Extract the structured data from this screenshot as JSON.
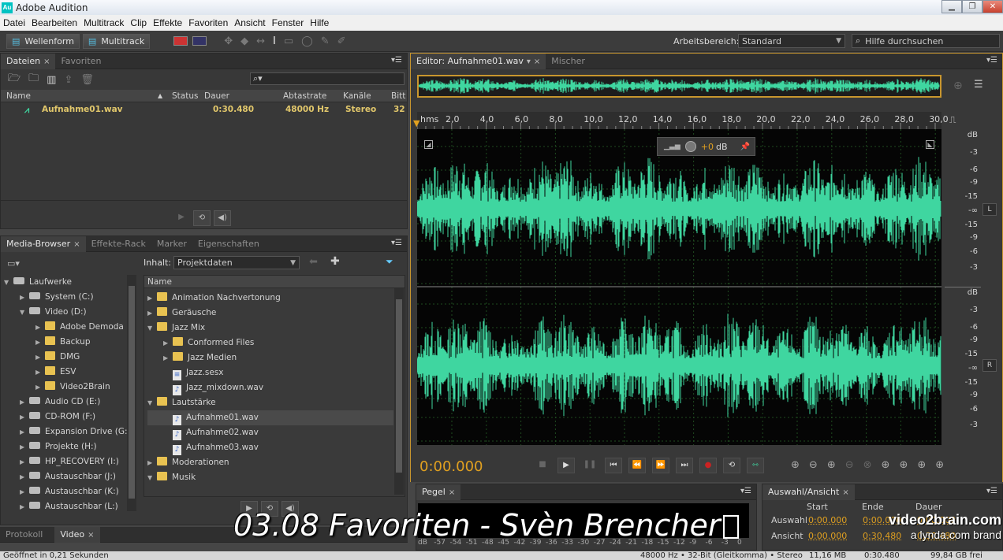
{
  "window": {
    "title": "Adobe Audition",
    "app_icon": "Au"
  },
  "menu": [
    "Datei",
    "Bearbeiten",
    "Multitrack",
    "Clip",
    "Effekte",
    "Favoriten",
    "Ansicht",
    "Fenster",
    "Hilfe"
  ],
  "toolbar": {
    "waveform_label": "Wellenform",
    "multitrack_label": "Multitrack",
    "workspace_label": "Arbeitsbereich:",
    "workspace_value": "Standard",
    "help_placeholder": "Hilfe durchsuchen"
  },
  "files_panel": {
    "tabs": [
      "Dateien",
      "Favoriten"
    ],
    "columns": [
      "Name",
      "Status",
      "Dauer",
      "Abtastrate",
      "Kanäle",
      "Bitt"
    ],
    "rows": [
      {
        "name": "Aufnahme01.wav",
        "status": "",
        "duration": "0:30.480",
        "samplerate": "48000 Hz",
        "channels": "Stereo",
        "bit": "32"
      }
    ]
  },
  "media_panel": {
    "tabs": [
      "Media-Browser",
      "Effekte-Rack",
      "Marker",
      "Eigenschaften"
    ],
    "content_label": "Inhalt:",
    "content_value": "Projektdaten",
    "drives": [
      {
        "label": "Laufwerke",
        "level": 0,
        "open": true,
        "type": "drive"
      },
      {
        "label": "System (C:)",
        "level": 1,
        "open": false,
        "type": "drive"
      },
      {
        "label": "Video (D:)",
        "level": 1,
        "open": true,
        "type": "drive"
      },
      {
        "label": "Adobe Demoda",
        "level": 2,
        "open": false,
        "type": "folder"
      },
      {
        "label": "Backup",
        "level": 2,
        "open": false,
        "type": "folder"
      },
      {
        "label": "DMG",
        "level": 2,
        "open": false,
        "type": "folder"
      },
      {
        "label": "ESV",
        "level": 2,
        "open": false,
        "type": "folder"
      },
      {
        "label": "Video2Brain",
        "level": 2,
        "open": false,
        "type": "folder"
      },
      {
        "label": "Audio CD (E:)",
        "level": 1,
        "open": false,
        "type": "drive"
      },
      {
        "label": "CD-ROM (F:)",
        "level": 1,
        "open": false,
        "type": "drive"
      },
      {
        "label": "Expansion Drive (G:",
        "level": 1,
        "open": false,
        "type": "drive"
      },
      {
        "label": "Projekte (H:)",
        "level": 1,
        "open": false,
        "type": "drive"
      },
      {
        "label": "HP_RECOVERY (I:)",
        "level": 1,
        "open": false,
        "type": "drive"
      },
      {
        "label": "Austauschbar (J:)",
        "level": 1,
        "open": false,
        "type": "drive"
      },
      {
        "label": "Austauschbar (K:)",
        "level": 1,
        "open": false,
        "type": "drive"
      },
      {
        "label": "Austauschbar (L:)",
        "level": 1,
        "open": false,
        "type": "drive"
      }
    ],
    "name_header": "Name",
    "items": [
      {
        "label": "Animation Nachvertonung",
        "level": 0,
        "open": false,
        "type": "folder"
      },
      {
        "label": "Geräusche",
        "level": 0,
        "open": false,
        "type": "folder"
      },
      {
        "label": "Jazz Mix",
        "level": 0,
        "open": true,
        "type": "folder"
      },
      {
        "label": "Conformed Files",
        "level": 1,
        "open": false,
        "type": "folder"
      },
      {
        "label": "Jazz Medien",
        "level": 1,
        "open": false,
        "type": "folder"
      },
      {
        "label": "Jazz.sesx",
        "level": 1,
        "open": null,
        "type": "session"
      },
      {
        "label": "Jazz_mixdown.wav",
        "level": 1,
        "open": null,
        "type": "audio"
      },
      {
        "label": "Lautstärke",
        "level": 0,
        "open": true,
        "type": "folder"
      },
      {
        "label": "Aufnahme01.wav",
        "level": 1,
        "open": null,
        "type": "audio",
        "selected": true
      },
      {
        "label": "Aufnahme02.wav",
        "level": 1,
        "open": null,
        "type": "audio"
      },
      {
        "label": "Aufnahme03.wav",
        "level": 1,
        "open": null,
        "type": "audio"
      },
      {
        "label": "Moderationen",
        "level": 0,
        "open": false,
        "type": "folder"
      },
      {
        "label": "Musik",
        "level": 0,
        "open": true,
        "type": "folder"
      }
    ]
  },
  "editor": {
    "tabs": [
      "Editor: Aufnahme01.wav",
      "Mischer"
    ],
    "ruler_unit": "hms",
    "ruler_ticks": [
      "2,0",
      "4,0",
      "6,0",
      "8,0",
      "10,0",
      "12,0",
      "14,0",
      "16,0",
      "18,0",
      "20,0",
      "22,0",
      "24,0",
      "26,0",
      "28,0",
      "30,0"
    ],
    "gain": "+0",
    "gain_unit": "dB",
    "db_scale": [
      "dB",
      "-3",
      "-6",
      "-9",
      "-15",
      "-∞",
      "-15",
      "-9",
      "-6",
      "-3"
    ],
    "channel_left": "L",
    "channel_right": "R",
    "time": "0:00.000",
    "waveform_color": "#3fd6a0"
  },
  "levels_panel": {
    "tab": "Pegel",
    "scale": [
      "dB",
      "-57",
      "-54",
      "-51",
      "-48",
      "-45",
      "-42",
      "-39",
      "-36",
      "-33",
      "-30",
      "-27",
      "-24",
      "-21",
      "-18",
      "-15",
      "-12",
      "-9",
      "-6",
      "-3",
      "0"
    ]
  },
  "selection_panel": {
    "tab": "Auswahl/Ansicht",
    "headers": [
      "Start",
      "Ende",
      "Dauer"
    ],
    "rows": [
      {
        "label": "Auswahl",
        "start": "0:00.000",
        "end": "0:00.000",
        "duration": "0:00.000"
      },
      {
        "label": "Ansicht",
        "start": "0:00.000",
        "end": "0:30.480",
        "duration": "0:30.480"
      }
    ]
  },
  "bottom_tabs": [
    "Protokoll",
    "Video"
  ],
  "status": {
    "left": "Geöffnet in 0,21 Sekunden",
    "format": "48000 Hz • 32-Bit (Gleitkomma) • Stereo",
    "size": "11,16 MB",
    "duration": "0:30.480",
    "free": "99,84 GB frei"
  },
  "overlay": {
    "title": "03.08 Favoriten - Svèn Brencher",
    "brand_line1": "video2brain.com",
    "brand_line2": "a lynda.com brand"
  }
}
